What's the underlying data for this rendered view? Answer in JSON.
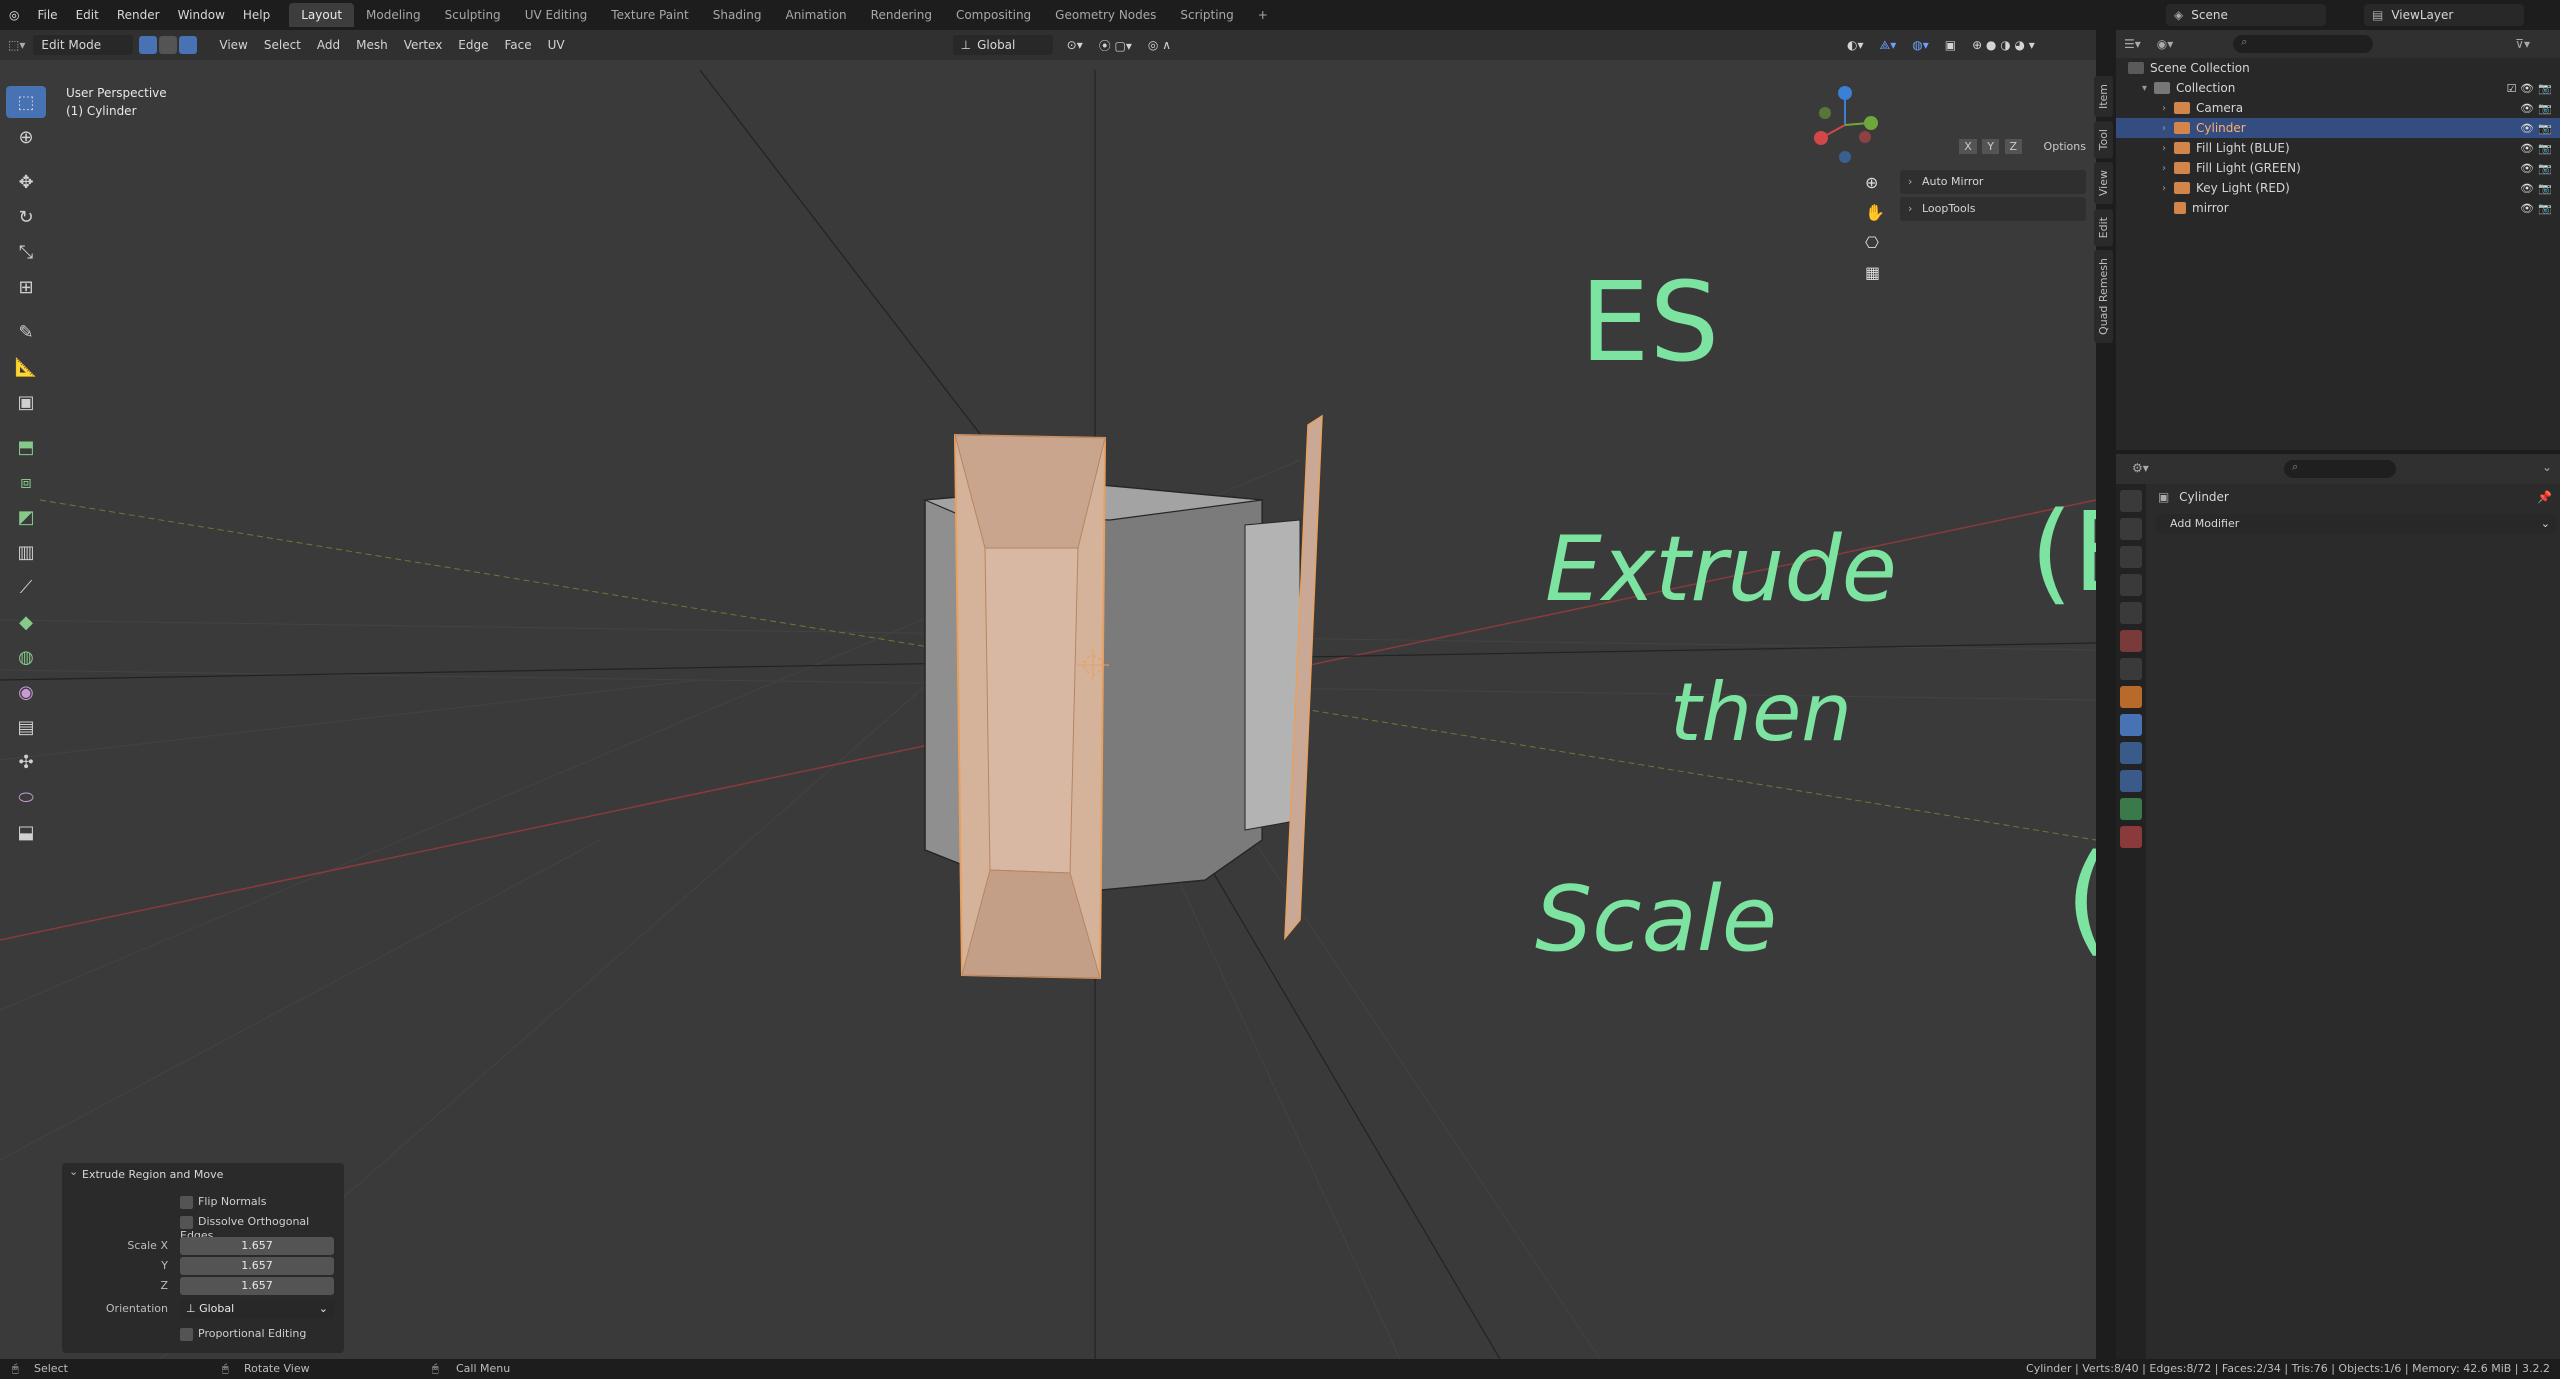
{
  "menubar": {
    "items": [
      "File",
      "Edit",
      "Render",
      "Window",
      "Help"
    ],
    "workspaces": [
      "Layout",
      "Modeling",
      "Sculpting",
      "UV Editing",
      "Texture Paint",
      "Shading",
      "Animation",
      "Rendering",
      "Compositing",
      "Geometry Nodes",
      "Scripting"
    ],
    "active_workspace": "Layout",
    "add_tab": "+",
    "scene": "Scene",
    "view_layer": "ViewLayer"
  },
  "viewport_header": {
    "mode": "Edit Mode",
    "menus": [
      "View",
      "Select",
      "Add",
      "Mesh",
      "Vertex",
      "Edge",
      "Face",
      "UV"
    ],
    "transform_orientation": "Global",
    "options": "Options",
    "axes": [
      "X",
      "Y",
      "Z"
    ]
  },
  "viewport": {
    "perspective": "User Perspective",
    "object_label": "(1) Cylinder",
    "side_tabs": [
      "Item",
      "Tool",
      "View",
      "Edit",
      "Quad Remesh"
    ],
    "n_panel": [
      "Auto Mirror",
      "LoopTools"
    ],
    "annotations": {
      "line1": "ES",
      "line2": "Extrude",
      "line2_key": "(E)",
      "line3": "then",
      "line4": "Scale",
      "line4_key": "(S)",
      "color": "#7de3a0"
    }
  },
  "outliner": {
    "root": "Scene Collection",
    "collection": "Collection",
    "items": [
      {
        "name": "Camera",
        "selected": false,
        "icon": "camera-icon"
      },
      {
        "name": "Cylinder",
        "selected": true,
        "icon": "mesh-icon"
      },
      {
        "name": "Fill Light (BLUE)",
        "selected": false,
        "icon": "light-icon"
      },
      {
        "name": "Fill Light (GREEN)",
        "selected": false,
        "icon": "light-icon"
      },
      {
        "name": "Key Light (RED)",
        "selected": false,
        "icon": "light-icon"
      },
      {
        "name": "mirror",
        "selected": false,
        "icon": "empty-icon"
      }
    ]
  },
  "properties": {
    "object": "Cylinder",
    "add_modifier": "Add Modifier"
  },
  "operator_panel": {
    "title": "Extrude Region and Move",
    "flip_normals": "Flip Normals",
    "dissolve": "Dissolve Orthogonal Edges",
    "scale_x_label": "Scale X",
    "y_label": "Y",
    "z_label": "Z",
    "scale_x": "1.657",
    "scale_y": "1.657",
    "scale_z": "1.657",
    "orientation_label": "Orientation",
    "orientation": "Global",
    "proportional": "Proportional Editing"
  },
  "statusbar": {
    "select": "Select",
    "rotate": "Rotate View",
    "call_menu": "Call Menu",
    "stats": "Cylinder | Verts:8/40 | Edges:8/72 | Faces:2/34 | Tris:76 | Objects:1/6 | Memory: 42.6 MiB | 3.2.2"
  },
  "colors": {
    "selection": "#e8a060",
    "accent": "#4772b3",
    "annotation": "#7de3a0"
  }
}
